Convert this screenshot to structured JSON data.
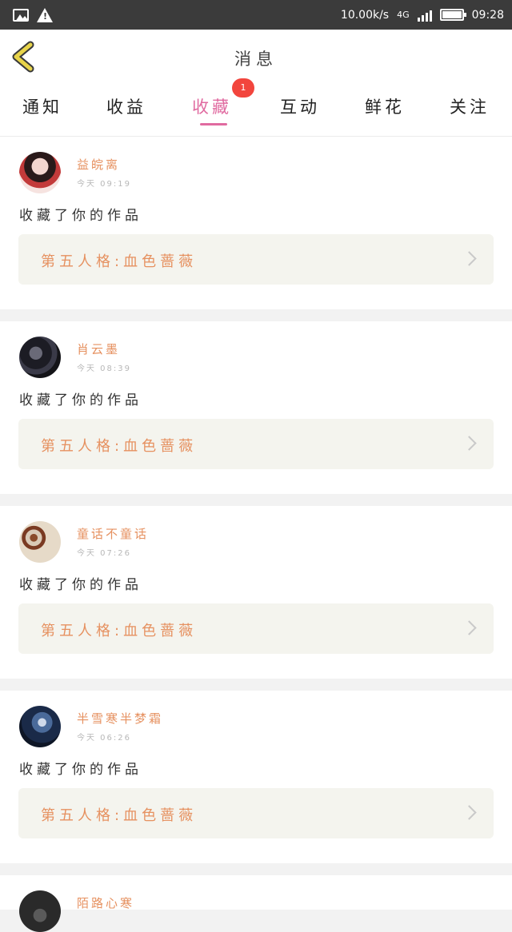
{
  "status_bar": {
    "net_speed": "10.00k/s",
    "network": "4G",
    "time": "09:28",
    "icons": [
      "image-icon",
      "warning-icon",
      "signal-icon",
      "battery-icon"
    ]
  },
  "header": {
    "title": "消息",
    "back_icon": "chevron-left-icon"
  },
  "tabs": [
    {
      "label": "通知"
    },
    {
      "label": "收益"
    },
    {
      "label": "收藏",
      "active": true,
      "badge": "1"
    },
    {
      "label": "互动"
    },
    {
      "label": "鲜花"
    },
    {
      "label": "关注"
    }
  ],
  "notifications": [
    {
      "user": "益皖离",
      "time": "今天 09:19",
      "action": "收藏了你的作品",
      "work": "第五人格:血色蔷薇"
    },
    {
      "user": "肖云墨",
      "time": "今天 08:39",
      "action": "收藏了你的作品",
      "work": "第五人格:血色蔷薇"
    },
    {
      "user": "童话不童话",
      "time": "今天 07:26",
      "action": "收藏了你的作品",
      "work": "第五人格:血色蔷薇"
    },
    {
      "user": "半雪寒半梦霜",
      "time": "今天 06:26",
      "action": "收藏了你的作品",
      "work": "第五人格:血色蔷薇"
    },
    {
      "user": "陌路心寒"
    }
  ],
  "colors": {
    "accent": "#e06aa0",
    "username": "#e69160",
    "badge": "#f2453d",
    "back_icon": "#e8d44a"
  }
}
